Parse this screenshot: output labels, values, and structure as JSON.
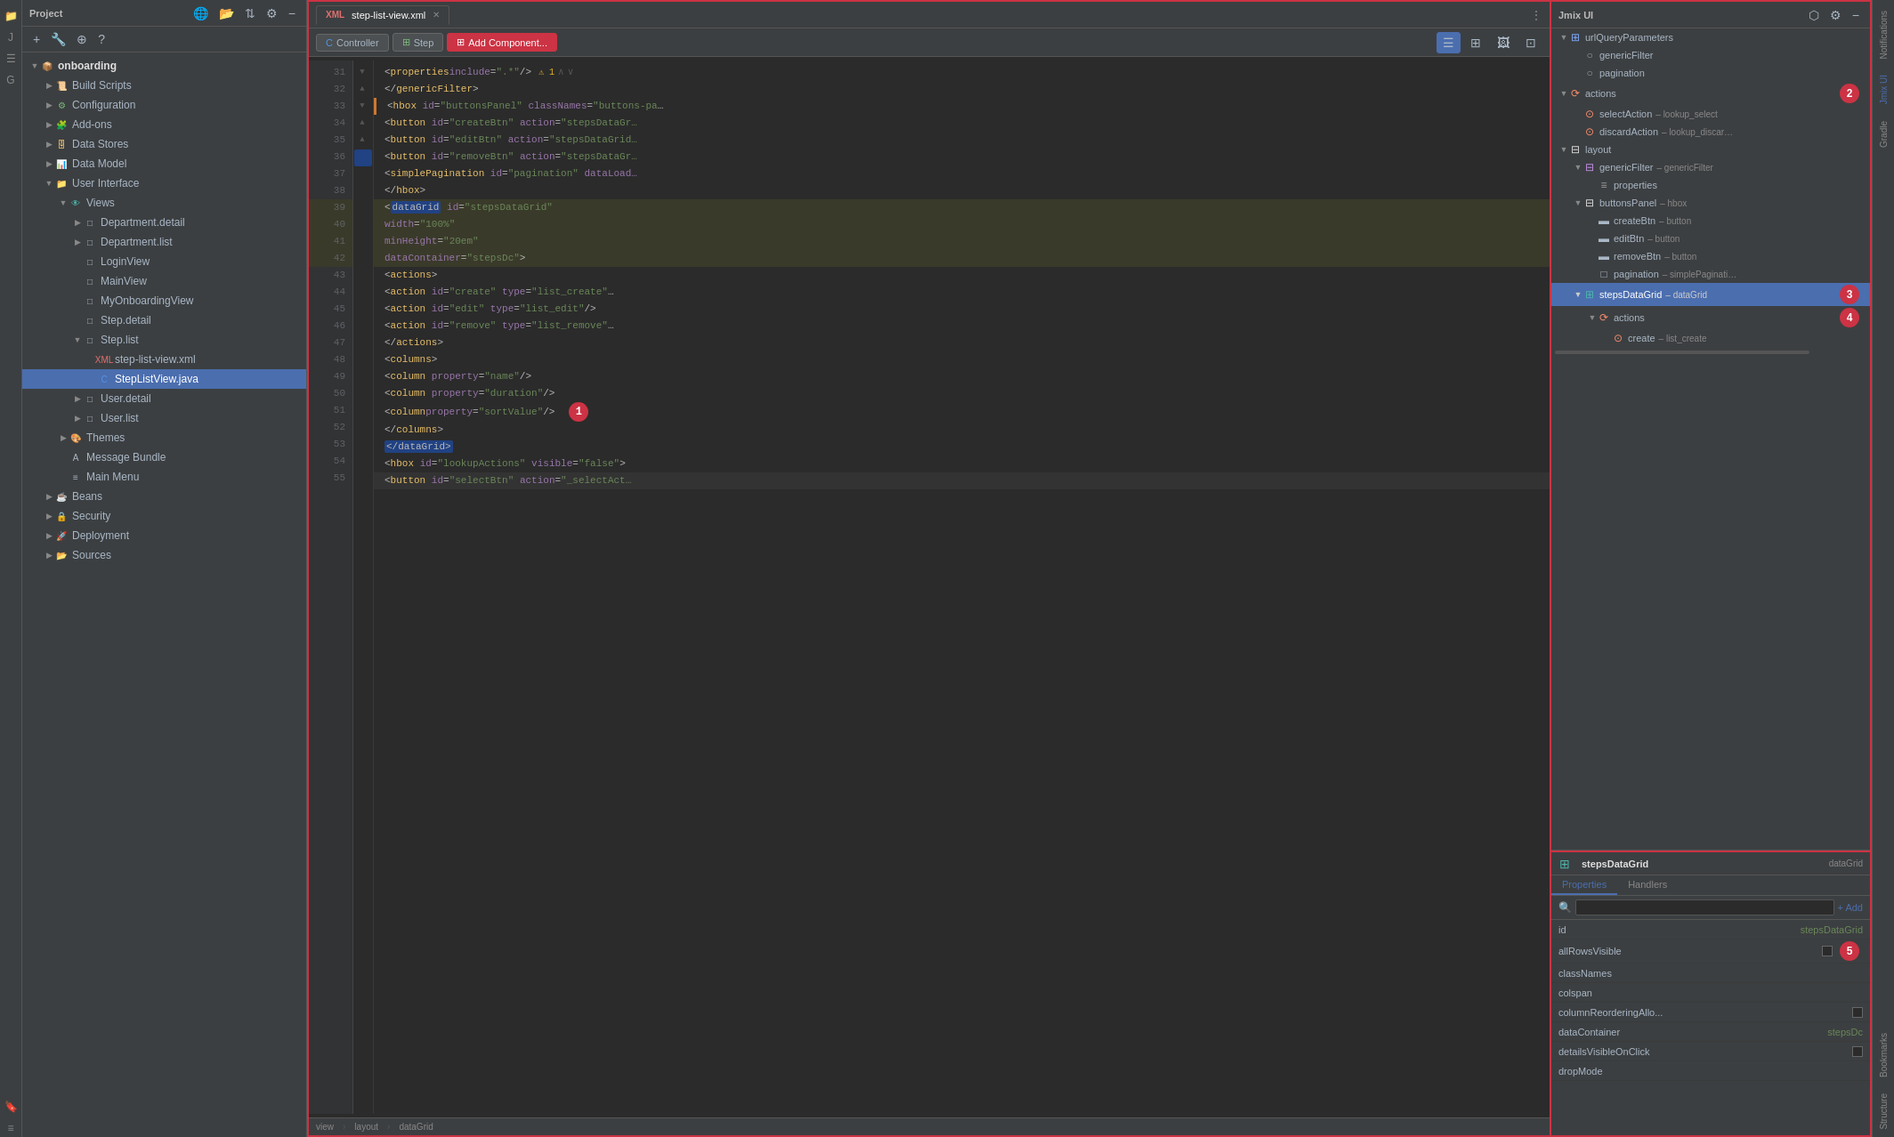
{
  "app": {
    "title": "Jmix",
    "project_label": "Project",
    "jmix_label": "Jmix",
    "jmixui_label": "Jmix UI",
    "gradle_label": "Gradle",
    "notifications_label": "Notifications",
    "bookmarks_label": "Bookmarks",
    "structure_label": "Structure"
  },
  "project_panel": {
    "title": "Project",
    "toolbar": [
      "+",
      "🔧",
      "⛶",
      "?"
    ]
  },
  "tree": {
    "root": "onboarding",
    "items": [
      {
        "id": "build-scripts",
        "label": "Build Scripts",
        "level": 1,
        "icon": "folder",
        "expandable": true
      },
      {
        "id": "configuration",
        "label": "Configuration",
        "level": 1,
        "icon": "config",
        "expandable": true
      },
      {
        "id": "add-ons",
        "label": "Add-ons",
        "level": 1,
        "icon": "leaf",
        "expandable": true
      },
      {
        "id": "data-stores",
        "label": "Data Stores",
        "level": 1,
        "icon": "data",
        "expandable": true
      },
      {
        "id": "data-model",
        "label": "Data Model",
        "level": 1,
        "icon": "data",
        "expandable": true
      },
      {
        "id": "user-interface",
        "label": "User Interface",
        "level": 1,
        "icon": "folder",
        "expandable": true
      },
      {
        "id": "views",
        "label": "Views",
        "level": 2,
        "icon": "view",
        "expandable": true
      },
      {
        "id": "dept-detail",
        "label": "Department.detail",
        "level": 3,
        "icon": "leaf",
        "expandable": true
      },
      {
        "id": "dept-list",
        "label": "Department.list",
        "level": 3,
        "icon": "leaf",
        "expandable": true
      },
      {
        "id": "login-view",
        "label": "LoginView",
        "level": 3,
        "icon": "leaf",
        "expandable": false
      },
      {
        "id": "main-view",
        "label": "MainView",
        "level": 3,
        "icon": "leaf",
        "expandable": false
      },
      {
        "id": "my-onboarding",
        "label": "MyOnboardingView",
        "level": 3,
        "icon": "leaf",
        "expandable": false
      },
      {
        "id": "step-detail",
        "label": "Step.detail",
        "level": 3,
        "icon": "leaf",
        "expandable": false
      },
      {
        "id": "step-list",
        "label": "Step.list",
        "level": 3,
        "icon": "folder",
        "expandable": true
      },
      {
        "id": "step-list-xml",
        "label": "step-list-view.xml",
        "level": 4,
        "icon": "xml",
        "expandable": false,
        "active": true
      },
      {
        "id": "step-list-java",
        "label": "StepListView.java",
        "level": 4,
        "icon": "java",
        "expandable": false,
        "selected": true
      },
      {
        "id": "user-detail",
        "label": "User.detail",
        "level": 3,
        "icon": "leaf",
        "expandable": true
      },
      {
        "id": "user-list",
        "label": "User.list",
        "level": 3,
        "icon": "leaf",
        "expandable": true
      },
      {
        "id": "themes",
        "label": "Themes",
        "level": 2,
        "icon": "theme",
        "expandable": true
      },
      {
        "id": "message-bundle",
        "label": "Message Bundle",
        "level": 2,
        "icon": "leaf",
        "expandable": false
      },
      {
        "id": "main-menu",
        "label": "Main Menu",
        "level": 2,
        "icon": "leaf",
        "expandable": false
      },
      {
        "id": "beans",
        "label": "Beans",
        "level": 1,
        "icon": "bean",
        "expandable": true
      },
      {
        "id": "security",
        "label": "Security",
        "level": 1,
        "icon": "security",
        "expandable": true
      },
      {
        "id": "deployment",
        "label": "Deployment",
        "level": 1,
        "icon": "deploy",
        "expandable": true
      },
      {
        "id": "sources",
        "label": "Sources",
        "level": 1,
        "icon": "source",
        "expandable": true
      }
    ]
  },
  "editor": {
    "tab_label": "step-list-view.xml",
    "toolbar_btns": [
      "Controller",
      "Step",
      "Add Component..."
    ],
    "view_btns": [
      "list",
      "split",
      "image",
      "image2"
    ],
    "lines": [
      {
        "num": 31,
        "content": "    <properties include=\".*\"/>",
        "gutter": "",
        "highlight": false,
        "warning": true
      },
      {
        "num": 32,
        "content": "</genericFilter>",
        "indent": "        ",
        "highlight": false
      },
      {
        "num": 33,
        "content": "<hbox id=\"buttonsPanel\" classNames=\"buttons-pa",
        "indent": "        ",
        "highlight": false
      },
      {
        "num": 34,
        "content": "    <button id=\"createBtn\" action=\"stepsDataGr",
        "indent": "            ",
        "highlight": false
      },
      {
        "num": 35,
        "content": "    <button id=\"editBtn\" action=\"stepsDataGrid",
        "indent": "            ",
        "highlight": false
      },
      {
        "num": 36,
        "content": "    <button id=\"removeBtn\" action=\"stepsDataGr",
        "indent": "            ",
        "highlight": false
      },
      {
        "num": 37,
        "content": "    <simplePagination id=\"pagination\" dataLoad",
        "indent": "            ",
        "highlight": false
      },
      {
        "num": 38,
        "content": "</hbox>",
        "indent": "        ",
        "highlight": false
      },
      {
        "num": 39,
        "content": "<dataGrid id=\"stepsDataGrid\"",
        "indent": "        ",
        "highlight": true,
        "selected": true
      },
      {
        "num": 40,
        "content": "        width=\"100%\"",
        "indent": "",
        "highlight": true
      },
      {
        "num": 41,
        "content": "        minHeight=\"20em\"",
        "indent": "",
        "highlight": true
      },
      {
        "num": 42,
        "content": "        dataContainer=\"stepsDc\">",
        "indent": "",
        "highlight": true
      },
      {
        "num": 43,
        "content": "    <actions>",
        "indent": "            ",
        "highlight": false
      },
      {
        "num": 44,
        "content": "        <action id=\"create\" type=\"list_create\"",
        "indent": "                ",
        "highlight": false
      },
      {
        "num": 45,
        "content": "        <action id=\"edit\" type=\"list_edit\"/>",
        "indent": "                ",
        "highlight": false
      },
      {
        "num": 46,
        "content": "        <action id=\"remove\" type=\"list_remove\"",
        "indent": "                ",
        "highlight": false
      },
      {
        "num": 47,
        "content": "    </actions>",
        "indent": "            ",
        "highlight": false
      },
      {
        "num": 48,
        "content": "    <columns>",
        "indent": "            ",
        "highlight": false
      },
      {
        "num": 49,
        "content": "        <column property=\"name\"/>",
        "indent": "                ",
        "highlight": false
      },
      {
        "num": 50,
        "content": "        <column property=\"duration\"/>",
        "indent": "                ",
        "highlight": false
      },
      {
        "num": 51,
        "content": "        <column property=\"sortValue\"/>",
        "indent": "                ",
        "highlight": false
      },
      {
        "num": 52,
        "content": "    </columns>",
        "indent": "            ",
        "highlight": false
      },
      {
        "num": 53,
        "content": "</dataGrid>",
        "indent": "        ",
        "highlight": false,
        "sel_tag": true
      },
      {
        "num": 54,
        "content": "<hbox id=\"lookupActions\" visible=\"false\">",
        "indent": "        ",
        "highlight": false
      },
      {
        "num": 55,
        "content": "    <button id=\"selectBtn\" action=\"_selectAct",
        "indent": "            ",
        "highlight": false
      }
    ],
    "status_bar": {
      "breadcrumb": [
        "view",
        "layout",
        "dataGrid"
      ]
    }
  },
  "jmix_ui": {
    "title": "Jmix UI",
    "tree": [
      {
        "id": "url-query-params",
        "label": "urlQueryParameters",
        "level": 0,
        "icon": "comp",
        "expandable": true
      },
      {
        "id": "generic-filter-node",
        "label": "genericFilter",
        "level": 1,
        "icon": "comp",
        "expandable": false
      },
      {
        "id": "pagination-node",
        "label": "pagination",
        "level": 1,
        "icon": "comp",
        "expandable": false
      },
      {
        "id": "actions-node",
        "label": "actions",
        "level": 0,
        "icon": "action",
        "expandable": true
      },
      {
        "id": "select-action",
        "label": "selectAction",
        "level": 1,
        "icon": "action",
        "expandable": false,
        "type": "– lookup_select"
      },
      {
        "id": "discard-action",
        "label": "discardAction",
        "level": 1,
        "icon": "action",
        "expandable": false,
        "type": "– lookup_discar..."
      },
      {
        "id": "layout-node",
        "label": "layout",
        "level": 0,
        "icon": "layout",
        "expandable": true
      },
      {
        "id": "generic-filter-layout",
        "label": "genericFilter",
        "level": 1,
        "icon": "filter",
        "expandable": true,
        "type": "– genericFilter"
      },
      {
        "id": "properties-node",
        "label": "properties",
        "level": 2,
        "icon": "comp",
        "expandable": false
      },
      {
        "id": "buttons-panel",
        "label": "buttonsPanel",
        "level": 1,
        "icon": "layout",
        "expandable": true,
        "type": "– hbox"
      },
      {
        "id": "create-btn",
        "label": "createBtn",
        "level": 2,
        "icon": "btn",
        "expandable": false,
        "type": "– button"
      },
      {
        "id": "edit-btn",
        "label": "editBtn",
        "level": 2,
        "icon": "btn",
        "expandable": false,
        "type": "– button"
      },
      {
        "id": "remove-btn",
        "label": "removeBtn",
        "level": 2,
        "icon": "btn",
        "expandable": false,
        "type": "– button"
      },
      {
        "id": "pagination-comp",
        "label": "pagination",
        "level": 2,
        "icon": "pag",
        "expandable": false,
        "type": "– simplePaginati..."
      },
      {
        "id": "steps-data-grid",
        "label": "stepsDataGrid",
        "level": 1,
        "icon": "grid",
        "expandable": true,
        "type": "– dataGrid",
        "selected": true
      },
      {
        "id": "actions-sub",
        "label": "actions",
        "level": 2,
        "icon": "action",
        "expandable": true
      },
      {
        "id": "create-action",
        "label": "create",
        "level": 3,
        "icon": "action",
        "expandable": false,
        "type": "– list_create"
      }
    ]
  },
  "properties_panel": {
    "component_name": "stepsDataGrid",
    "component_type": "dataGrid",
    "tabs": [
      "Properties",
      "Handlers"
    ],
    "search_placeholder": "🔍",
    "add_label": "+ Add",
    "properties": [
      {
        "name": "id",
        "value": "stepsDataGrid",
        "type": "text"
      },
      {
        "name": "allRowsVisible",
        "value": "",
        "type": "checkbox"
      },
      {
        "name": "classNames",
        "value": "",
        "type": "text"
      },
      {
        "name": "colspan",
        "value": "",
        "type": "text"
      },
      {
        "name": "columnReorderingAllo...",
        "value": "",
        "type": "checkbox"
      },
      {
        "name": "dataContainer",
        "value": "stepsDc",
        "type": "text"
      },
      {
        "name": "detailsVisibleOnClick",
        "value": "",
        "type": "checkbox"
      },
      {
        "name": "dropMode",
        "value": "",
        "type": "text"
      }
    ]
  },
  "annotations": {
    "badge1": "1",
    "badge2": "2",
    "badge3": "3",
    "badge4": "4",
    "badge5": "5"
  }
}
